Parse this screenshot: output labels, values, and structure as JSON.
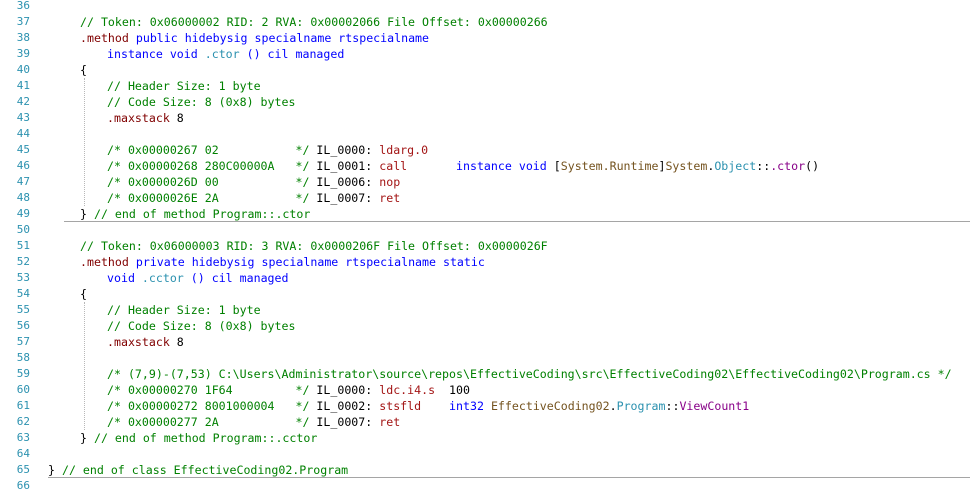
{
  "colors": {
    "line_number": "#2b91af",
    "comment": "#008000",
    "keyword": "#0000ff",
    "directive": "#800000",
    "opcode": "#a31515",
    "type": "#2b91af",
    "namespace": "#74531f",
    "member": "#880088"
  },
  "lines": [
    {
      "n": "36",
      "segs": []
    },
    {
      "n": "37",
      "indent": 1,
      "segs": [
        {
          "t": "// Token: 0x06000002 RID: 2 RVA: 0x00002066 File Offset: 0x00000266",
          "c": "c"
        }
      ]
    },
    {
      "n": "38",
      "indent": 1,
      "segs": [
        {
          "t": ".method",
          "c": "d"
        },
        {
          "t": " public hidebysig specialname rtspecialname",
          "c": "k"
        }
      ]
    },
    {
      "n": "39",
      "indent": 2,
      "segs": [
        {
          "t": "instance void ",
          "c": "k"
        },
        {
          "t": ".ctor",
          "c": "t"
        },
        {
          "t": " () cil managed",
          "c": "k"
        }
      ]
    },
    {
      "n": "40",
      "indent": 1,
      "segs": [
        {
          "t": "{",
          "c": "p"
        }
      ]
    },
    {
      "n": "41",
      "indent": 2,
      "segs": [
        {
          "t": "// Header Size: 1 byte",
          "c": "c"
        }
      ]
    },
    {
      "n": "42",
      "indent": 2,
      "segs": [
        {
          "t": "// Code Size: 8 (0x8) bytes",
          "c": "c"
        }
      ]
    },
    {
      "n": "43",
      "indent": 2,
      "segs": [
        {
          "t": ".maxstack",
          "c": "d"
        },
        {
          "t": " 8",
          "c": "p"
        }
      ]
    },
    {
      "n": "44",
      "segs": []
    },
    {
      "n": "45",
      "indent": 2,
      "segs": [
        {
          "t": "/* 0x00000267 02           */ ",
          "c": "c"
        },
        {
          "t": "IL_0000: ",
          "c": "p"
        },
        {
          "t": "ldarg.0",
          "c": "o"
        }
      ]
    },
    {
      "n": "46",
      "indent": 2,
      "segs": [
        {
          "t": "/* 0x00000268 280C00000A   */ ",
          "c": "c"
        },
        {
          "t": "IL_0001: ",
          "c": "p"
        },
        {
          "t": "call",
          "c": "o"
        },
        {
          "t": "       instance void ",
          "c": "k"
        },
        {
          "t": "[",
          "c": "p"
        },
        {
          "t": "System.Runtime",
          "c": "m"
        },
        {
          "t": "]",
          "c": "p"
        },
        {
          "t": "System",
          "c": "m"
        },
        {
          "t": ".",
          "c": "p"
        },
        {
          "t": "Object",
          "c": "t"
        },
        {
          "t": "::",
          "c": "p"
        },
        {
          "t": ".ctor",
          "c": "n"
        },
        {
          "t": "()",
          "c": "p"
        }
      ]
    },
    {
      "n": "47",
      "indent": 2,
      "segs": [
        {
          "t": "/* 0x0000026D 00           */ ",
          "c": "c"
        },
        {
          "t": "IL_0006: ",
          "c": "p"
        },
        {
          "t": "nop",
          "c": "o"
        }
      ]
    },
    {
      "n": "48",
      "indent": 2,
      "segs": [
        {
          "t": "/* 0x0000026E 2A           */ ",
          "c": "c"
        },
        {
          "t": "IL_0007: ",
          "c": "p"
        },
        {
          "t": "ret",
          "c": "o"
        }
      ]
    },
    {
      "n": "49",
      "indent": 1,
      "segs": [
        {
          "t": "} ",
          "c": "p"
        },
        {
          "t": "// end of method Program::.ctor",
          "c": "c"
        }
      ]
    },
    {
      "n": "50",
      "segs": []
    },
    {
      "n": "51",
      "indent": 1,
      "segs": [
        {
          "t": "// Token: 0x06000003 RID: 3 RVA: 0x0000206F File Offset: 0x0000026F",
          "c": "c"
        }
      ]
    },
    {
      "n": "52",
      "indent": 1,
      "segs": [
        {
          "t": ".method",
          "c": "d"
        },
        {
          "t": " private hidebysig specialname rtspecialname static",
          "c": "k"
        }
      ]
    },
    {
      "n": "53",
      "indent": 2,
      "segs": [
        {
          "t": "void ",
          "c": "k"
        },
        {
          "t": ".cctor",
          "c": "t"
        },
        {
          "t": " () cil managed",
          "c": "k"
        }
      ]
    },
    {
      "n": "54",
      "indent": 1,
      "segs": [
        {
          "t": "{",
          "c": "p"
        }
      ]
    },
    {
      "n": "55",
      "indent": 2,
      "segs": [
        {
          "t": "// Header Size: 1 byte",
          "c": "c"
        }
      ]
    },
    {
      "n": "56",
      "indent": 2,
      "segs": [
        {
          "t": "// Code Size: 8 (0x8) bytes",
          "c": "c"
        }
      ]
    },
    {
      "n": "57",
      "indent": 2,
      "segs": [
        {
          "t": ".maxstack",
          "c": "d"
        },
        {
          "t": " 8",
          "c": "p"
        }
      ]
    },
    {
      "n": "58",
      "segs": []
    },
    {
      "n": "59",
      "indent": 2,
      "segs": [
        {
          "t": "/* (7,9)-(7,53) C:\\Users\\Administrator\\source\\repos\\EffectiveCoding\\src\\EffectiveCoding02\\EffectiveCoding02\\Program.cs */",
          "c": "c"
        }
      ]
    },
    {
      "n": "60",
      "indent": 2,
      "segs": [
        {
          "t": "/* 0x00000270 1F64         */ ",
          "c": "c"
        },
        {
          "t": "IL_0000: ",
          "c": "p"
        },
        {
          "t": "ldc.i4.s",
          "c": "o"
        },
        {
          "t": "  100",
          "c": "p"
        }
      ]
    },
    {
      "n": "61",
      "indent": 2,
      "segs": [
        {
          "t": "/* 0x00000272 8001000004   */ ",
          "c": "c"
        },
        {
          "t": "IL_0002: ",
          "c": "p"
        },
        {
          "t": "stsfld",
          "c": "o"
        },
        {
          "t": "    int32 ",
          "c": "k"
        },
        {
          "t": "EffectiveCoding02",
          "c": "m"
        },
        {
          "t": ".",
          "c": "p"
        },
        {
          "t": "Program",
          "c": "t"
        },
        {
          "t": "::",
          "c": "p"
        },
        {
          "t": "ViewCount1",
          "c": "n"
        }
      ]
    },
    {
      "n": "62",
      "indent": 2,
      "segs": [
        {
          "t": "/* 0x00000277 2A           */ ",
          "c": "c"
        },
        {
          "t": "IL_0007: ",
          "c": "p"
        },
        {
          "t": "ret",
          "c": "o"
        }
      ]
    },
    {
      "n": "63",
      "indent": 1,
      "segs": [
        {
          "t": "} ",
          "c": "p"
        },
        {
          "t": "// end of method Program::.cctor",
          "c": "c"
        }
      ]
    },
    {
      "n": "64",
      "segs": []
    },
    {
      "n": "65",
      "indent": 0,
      "segs": [
        {
          "t": "} ",
          "c": "p"
        },
        {
          "t": "// end of class EffectiveCoding02.Program",
          "c": "c"
        }
      ]
    },
    {
      "n": "66",
      "segs": []
    }
  ]
}
